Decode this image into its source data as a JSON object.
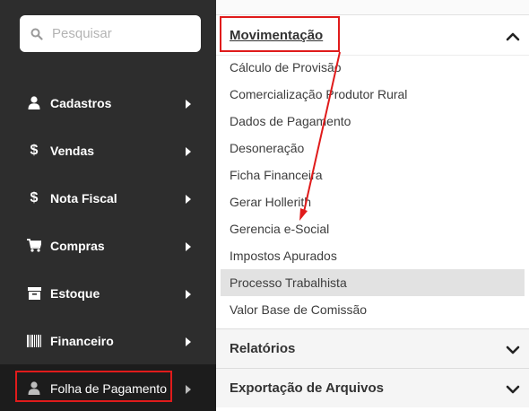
{
  "search": {
    "placeholder": "Pesquisar"
  },
  "sidebar": {
    "items": [
      {
        "label": "Cadastros",
        "icon": "user-icon"
      },
      {
        "label": "Vendas",
        "icon": "dollar-icon"
      },
      {
        "label": "Nota Fiscal",
        "icon": "dollar-icon"
      },
      {
        "label": "Compras",
        "icon": "cart-icon"
      },
      {
        "label": "Estoque",
        "icon": "box-icon"
      },
      {
        "label": "Financeiro",
        "icon": "barcode-icon"
      },
      {
        "label": "Folha de Pagamento",
        "icon": "user-icon"
      }
    ]
  },
  "panel": {
    "movimentacao": {
      "title": "Movimentação",
      "items": [
        {
          "label": "Cálculo de Provisão"
        },
        {
          "label": "Comercialização Produtor Rural"
        },
        {
          "label": "Dados de Pagamento"
        },
        {
          "label": "Desoneração"
        },
        {
          "label": "Ficha Financeira"
        },
        {
          "label": "Gerar Hollerith"
        },
        {
          "label": "Gerencia e-Social"
        },
        {
          "label": "Impostos Apurados"
        },
        {
          "label": "Processo Trabalhista",
          "active": true
        },
        {
          "label": "Valor Base de Comissão"
        }
      ]
    },
    "sections": [
      {
        "label": "Relatórios"
      },
      {
        "label": "Exportação de Arquivos"
      }
    ]
  },
  "colors": {
    "sidebar_bg": "#2d2d2d",
    "sidebar_active_bg": "#1c1c1c",
    "highlight_red": "#e01b1b",
    "active_item_bg": "#e2e2e2"
  }
}
